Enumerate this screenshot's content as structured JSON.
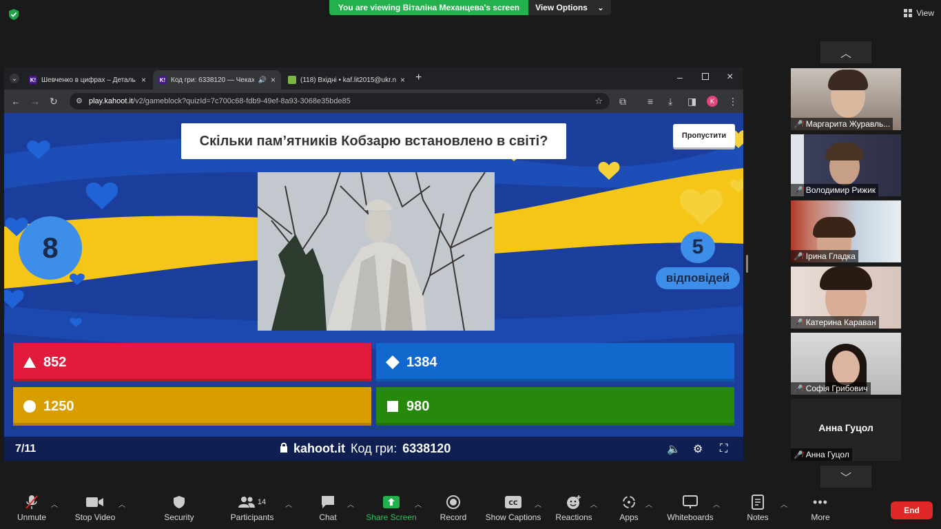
{
  "banner": {
    "message": "You are viewing Віталіна Механцева's screen",
    "options_label": "View Options"
  },
  "view": {
    "label": "View"
  },
  "browser": {
    "tabs": [
      {
        "title": "Шевченко в цифрах – Деталь",
        "icon": "K!"
      },
      {
        "title": "Код гри: 6338120 — Чеках",
        "icon": "K!"
      },
      {
        "title": "(118) Вхідні • kaf.lit2015@ukr.n",
        "icon": "mail"
      }
    ],
    "url_host": "play.kahoot.it",
    "url_path": "/v2/gameblock?quizId=7c700c68-fdb9-49ef-8a93-3068e35bde85",
    "profile_initial": "K"
  },
  "kahoot": {
    "question": "Скільки пам’ятників Кобзарю встановлено в світі?",
    "skip_label": "Пропустити",
    "timer": "8",
    "answers_count": "5",
    "answers_label": "відповідей",
    "answers": [
      {
        "label": "852",
        "shape": "triangle",
        "color": "#e21b3c"
      },
      {
        "label": "1384",
        "shape": "diamond",
        "color": "#1368ce"
      },
      {
        "label": "1250",
        "shape": "circle",
        "color": "#d89e00"
      },
      {
        "label": "980",
        "shape": "square",
        "color": "#26890c"
      }
    ],
    "progress": "7/11",
    "brand": "kahoot.it",
    "game_pin_label": "Код гри:",
    "game_pin": "6338120"
  },
  "participants": [
    {
      "name": "Маргарита Журавль..."
    },
    {
      "name": "Володимир Рижик"
    },
    {
      "name": "Ірина Гладка"
    },
    {
      "name": "Катерина Караван"
    },
    {
      "name": "Софія Грибович"
    },
    {
      "name": "Анна Гуцол",
      "display": "Анна Гуцол"
    }
  ],
  "toolbar": {
    "unmute": "Unmute",
    "stop_video": "Stop Video",
    "security": "Security",
    "participants": "Participants",
    "participants_count": "14",
    "chat": "Chat",
    "share_screen": "Share Screen",
    "record": "Record",
    "show_captions": "Show Captions",
    "reactions": "Reactions",
    "apps": "Apps",
    "whiteboards": "Whiteboards",
    "notes": "Notes",
    "more": "More",
    "end": "End"
  },
  "colors": {
    "share_green": "#22b14c",
    "end_red": "#e02828",
    "kahoot_blue": "#1b3d9c",
    "ukraine_yellow": "#f5c518"
  }
}
